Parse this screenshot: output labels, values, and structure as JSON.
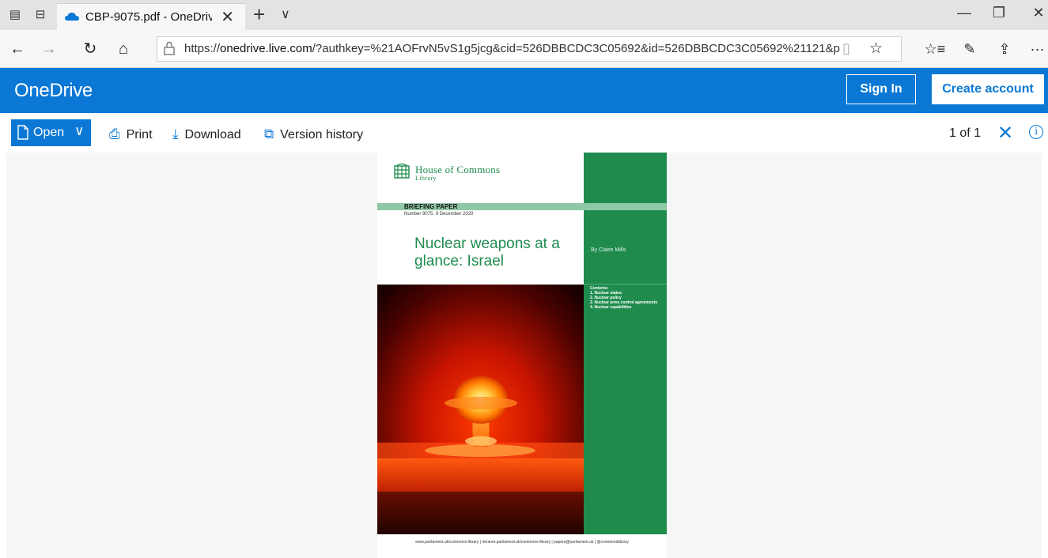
{
  "browser": {
    "tab": {
      "title": "CBP-9075.pdf - OneDriv",
      "close_glyph": "✕"
    },
    "new_tab_glyph": "+",
    "tab_list_glyph": "∨",
    "window": {
      "minimize": "—",
      "restore": "❐",
      "close": "✕"
    },
    "nav": {
      "back": "←",
      "forward": "→",
      "refresh": "↻",
      "home": "⌂"
    },
    "address": {
      "host": "onedrive.live.com",
      "prefix": "https://",
      "rest": "/?authkey=%21AOFrvN5vS1g5jcg&cid=526DBBCDC3C05692&id=526DBBCDC3C05692%21121&p"
    },
    "tools": {
      "favorite": "☆",
      "favorites_list": "☆≡",
      "notes": "✎",
      "share": "⇪",
      "more": "···"
    }
  },
  "onedrive": {
    "brand": "OneDrive",
    "sign_in": "Sign In",
    "create_account": "Create account",
    "accent": "#0a78d4"
  },
  "commands": {
    "open": "Open",
    "print": "Print",
    "download": "Download",
    "version_history": "Version history",
    "pager": "1 of 1",
    "close_glyph": "✕",
    "info_glyph": "i"
  },
  "pdf": {
    "org_name": "House of Commons",
    "org_sub": "Library",
    "paper_type": "BRIEFING PAPER",
    "paper_number": "Number 9075, 9 December 2020",
    "title": "Nuclear weapons at a glance: Israel",
    "author": "By Claire Mills",
    "contents_heading": "Contents:",
    "contents": [
      "1.  Nuclear status",
      "2.  Nuclear policy",
      "3.  Nuclear arms control agreements",
      "4.  Nuclear capabilities"
    ],
    "footer": "www.parliament.uk/commons-library | intranet.parliament.uk/commons-library | papers@parliament.uk | @commonslibrary",
    "brand_green": "#1f8c4e"
  }
}
